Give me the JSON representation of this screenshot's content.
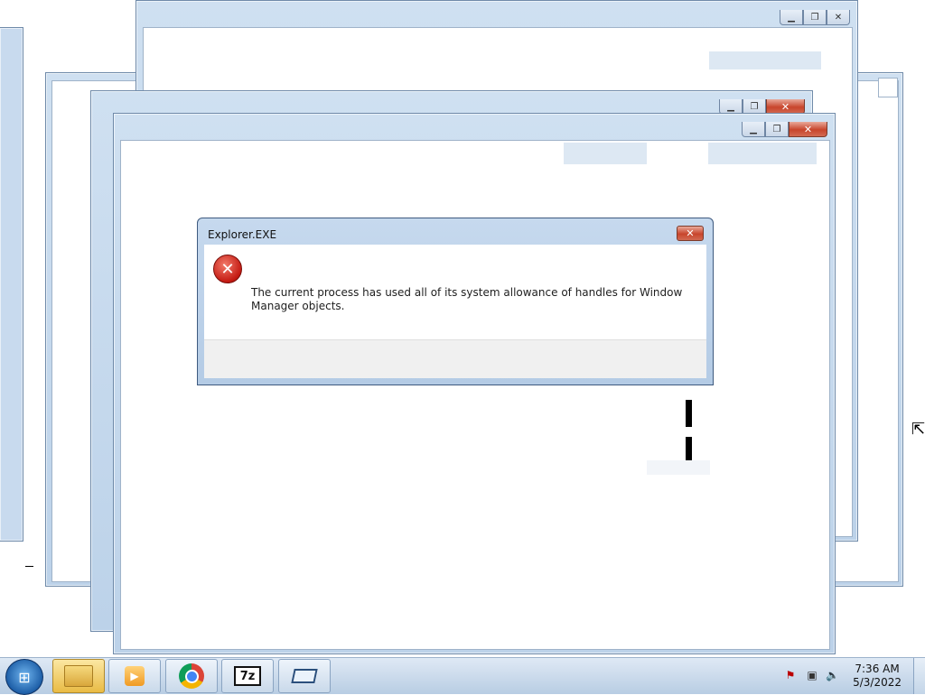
{
  "dialog": {
    "title": "Explorer.EXE",
    "close_glyph": "✕",
    "message": "The current process has used all of its system allowance of handles for Window Manager objects.",
    "icon": "error-icon"
  },
  "window_controls": {
    "minimize": "▁",
    "restore": "❐",
    "close": "✕"
  },
  "taskbar": {
    "start_icon": "windows-logo-icon",
    "buttons": [
      {
        "name": "windows-explorer",
        "icon": "folder-icon",
        "active": true
      },
      {
        "name": "media-player",
        "icon": "media-player-icon",
        "glyph": "▶"
      },
      {
        "name": "google-chrome",
        "icon": "chrome-icon"
      },
      {
        "name": "7-zip",
        "icon": "7zip-icon",
        "label": "7z"
      },
      {
        "name": "virtual-machine",
        "icon": "vm-icon"
      }
    ],
    "tray": {
      "flag_glyph": "⚑",
      "network_glyph": "▣",
      "volume_glyph": "🔈",
      "time": "7:36 AM",
      "date": "5/3/2022"
    }
  },
  "colors": {
    "accent": "#1d5ea7",
    "close_red": "#c8452c",
    "error_red": "#c41a12"
  }
}
